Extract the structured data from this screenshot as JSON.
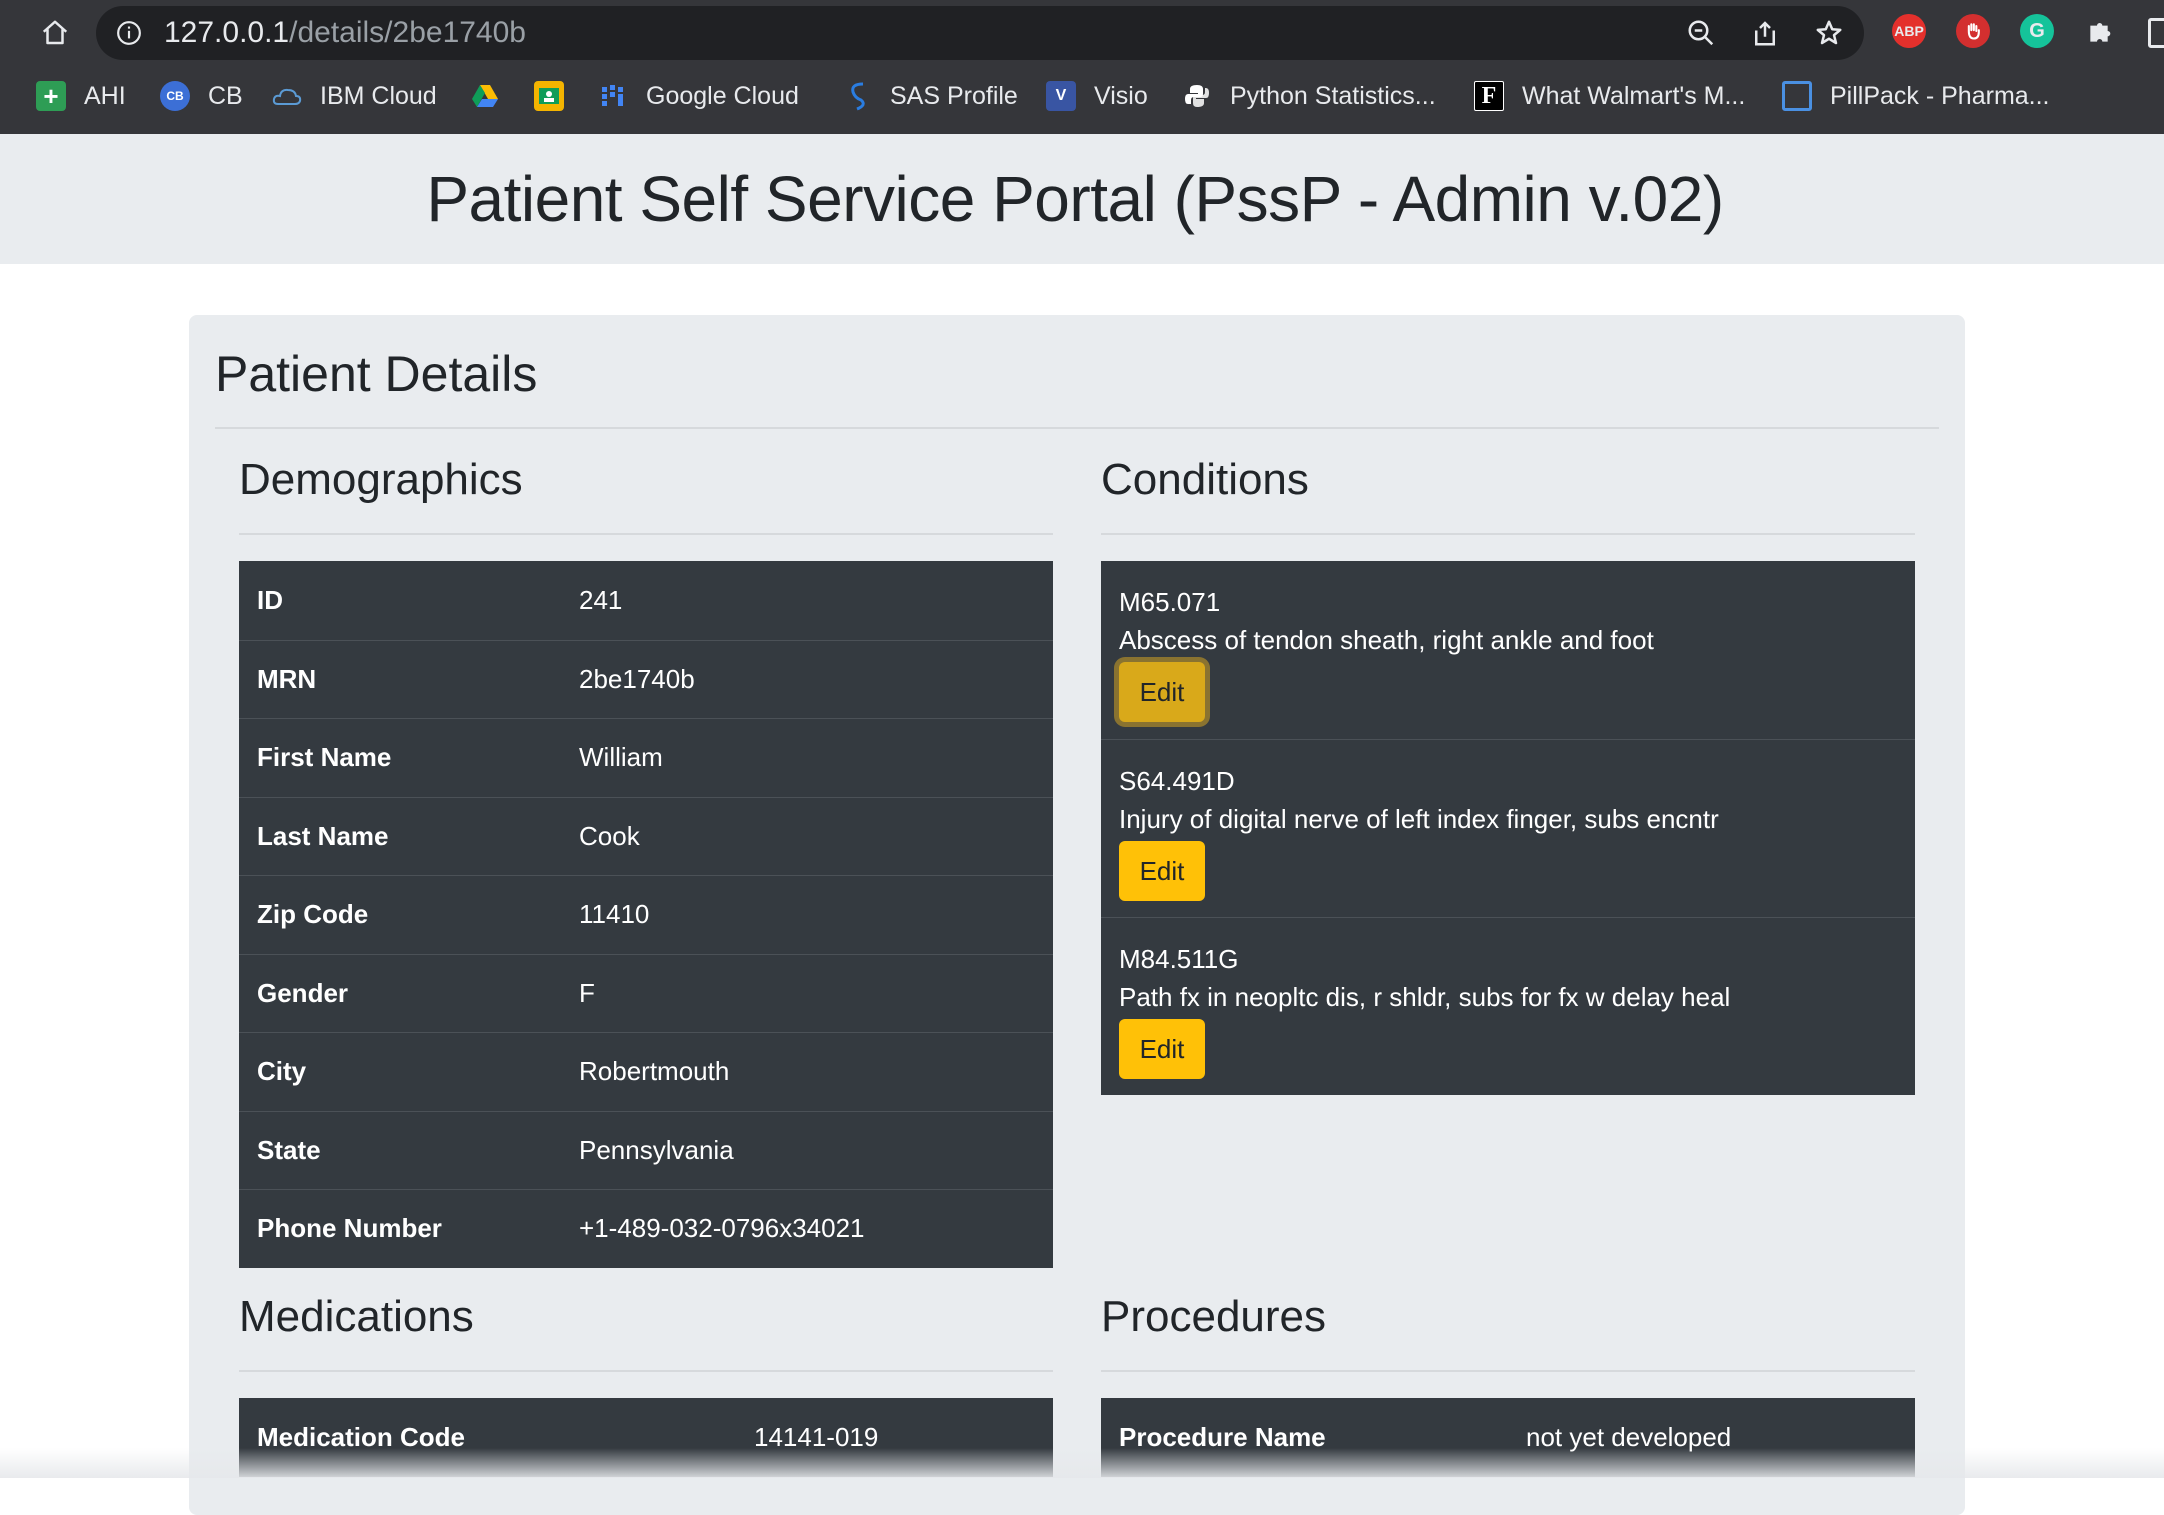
{
  "browser": {
    "url_host": "127.0.0.1",
    "url_path": "/details/2be1740b",
    "extensions": [
      {
        "name": "abp-icon",
        "label": "ABP",
        "color": "#e4302c"
      },
      {
        "name": "hand-stop-icon",
        "label": "",
        "color": "#d32f2f"
      },
      {
        "name": "grammarly-icon",
        "label": "G",
        "color": "#15c39a"
      }
    ],
    "bookmarks": [
      {
        "label": "AHI",
        "icon": "plus-icon",
        "color": "#2e9d55"
      },
      {
        "label": "CB",
        "icon": "cb-icon",
        "color": "#3c6fd6"
      },
      {
        "label": "IBM Cloud",
        "icon": "cloud-icon",
        "color": "#5b9bd5"
      },
      {
        "label": "",
        "icon": "drive-icon",
        "color": "#fbbc04"
      },
      {
        "label": "",
        "icon": "classroom-icon",
        "color": "#f4b400"
      },
      {
        "label": "Google Cloud",
        "icon": "grid-icon",
        "color": "#4285f4"
      },
      {
        "label": "SAS Profile",
        "icon": "sas-icon",
        "color": "#2a7de1"
      },
      {
        "label": "Visio",
        "icon": "visio-icon",
        "color": "#3955a3"
      },
      {
        "label": "Python Statistics...",
        "icon": "python-icon",
        "color": "#ffffff"
      },
      {
        "label": "What Walmart's M...",
        "icon": "f-icon",
        "color": "#000000"
      },
      {
        "label": "PillPack - Pharma...",
        "icon": "square-icon",
        "color": "#4a90e2"
      }
    ]
  },
  "page": {
    "title": "Patient Self Service Portal (PssP - Admin v.02)",
    "card_title": "Patient Details"
  },
  "demographics": {
    "title": "Demographics",
    "rows": [
      {
        "label": "ID",
        "value": "241"
      },
      {
        "label": "MRN",
        "value": "2be1740b"
      },
      {
        "label": "First Name",
        "value": "William"
      },
      {
        "label": "Last Name",
        "value": "Cook"
      },
      {
        "label": "Zip Code",
        "value": "11410"
      },
      {
        "label": "Gender",
        "value": "F"
      },
      {
        "label": "City",
        "value": "Robertmouth"
      },
      {
        "label": "State",
        "value": "Pennsylvania"
      },
      {
        "label": "Phone Number",
        "value": "+1-489-032-0796x34021"
      }
    ]
  },
  "conditions": {
    "title": "Conditions",
    "edit_label": "Edit",
    "items": [
      {
        "code": "M65.071",
        "description": "Abscess of tendon sheath, right ankle and foot"
      },
      {
        "code": "S64.491D",
        "description": "Injury of digital nerve of left index finger, subs encntr"
      },
      {
        "code": "M84.511G",
        "description": "Path fx in neopltc dis, r shldr, subs for fx w delay heal"
      }
    ]
  },
  "medications": {
    "title": "Medications",
    "rows": [
      {
        "label": "Medication Code",
        "value": "14141-019"
      }
    ]
  },
  "procedures": {
    "title": "Procedures",
    "rows": [
      {
        "label": "Procedure Name",
        "value": "not yet developed"
      }
    ]
  }
}
